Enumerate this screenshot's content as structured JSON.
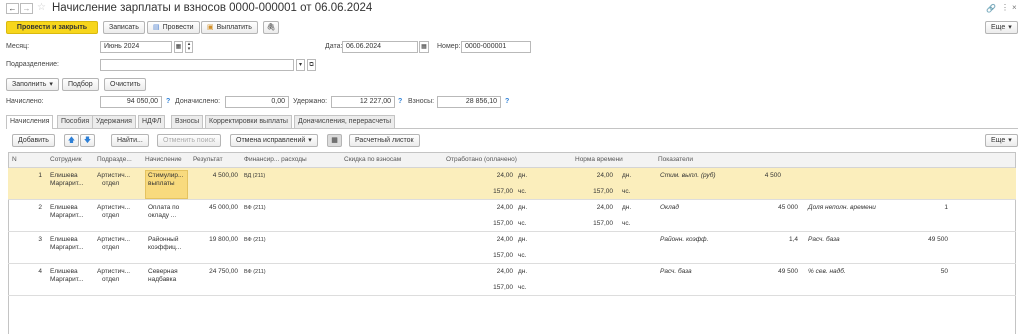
{
  "window": {
    "title": "Начисление зарплаты и взносов 0000-000001 от 06.06.2024",
    "more_label": "Еще"
  },
  "toolbar": {
    "post_close": "Провести и закрыть",
    "save": "Записать",
    "post": "Провести",
    "pay": "Выплатить"
  },
  "form": {
    "month_label": "Месяц:",
    "month_value": "Июнь 2024",
    "date_label": "Дата:",
    "date_value": "06.06.2024",
    "number_label": "Номер:",
    "number_value": "0000-000001",
    "division_label": "Подразделение:",
    "division_value": "",
    "fill_button": "Заполнить",
    "selection_button": "Подбор",
    "clear_button": "Очистить",
    "accrued_label": "Начислено:",
    "accrued_value": "94 050,00",
    "additional_label": "Доначислено:",
    "additional_value": "0,00",
    "withheld_label": "Удержано:",
    "withheld_value": "12 227,00",
    "contrib_label": "Взносы:",
    "contrib_value": "28 856,10",
    "help": "?"
  },
  "tabs": [
    "Начисления",
    "Пособия",
    "Удержания",
    "НДФЛ",
    "Взносы",
    "Корректировки выплаты",
    "Доначисления, перерасчеты"
  ],
  "table_toolbar": {
    "add": "Добавить",
    "find": "Найти...",
    "cancel_search": "Отменить поиск",
    "cancel_fix": "Отмена исправлений",
    "payslip": "Расчетный листок",
    "more": "Еще"
  },
  "columns": [
    "N",
    "Сотрудник",
    "Подразде...",
    "Начисление",
    "Результат",
    "Финансир... расходы",
    "Скидка по взносам",
    "Отработано (оплачено)",
    "Норма времени",
    "Показатели"
  ],
  "rows": [
    {
      "n": "1",
      "emp1": "Елишева",
      "emp2": "Маргарит...",
      "dep1": "Артистич...",
      "dep2": "отдел",
      "acc1": "Стимулир...",
      "acc2": "выплаты",
      "result": "4 500,00",
      "fin": "ВД (211)",
      "days": "24,00",
      "days_u": "дн.",
      "hours": "157,00",
      "hours_u": "чс.",
      "norm_d": "24,00",
      "norm_du": "дн.",
      "norm_h": "157,00",
      "norm_hu": "чс.",
      "ind1": "Стим. выпл. (руб)",
      "ind1v": "4 500",
      "ind2": "",
      "ind2v": ""
    },
    {
      "n": "2",
      "emp1": "Елишева",
      "emp2": "Маргарит...",
      "dep1": "Артистич...",
      "dep2": "отдел",
      "acc1": "Оплата по",
      "acc2": "окладу ...",
      "result": "45 000,00",
      "fin": "ВФ (211)",
      "days": "24,00",
      "days_u": "дн.",
      "hours": "157,00",
      "hours_u": "чс.",
      "norm_d": "24,00",
      "norm_du": "дн.",
      "norm_h": "157,00",
      "norm_hu": "чс.",
      "ind1": "Оклад",
      "ind1v": "45 000",
      "ind2": "Доля неполн. времени",
      "ind2v": "1"
    },
    {
      "n": "3",
      "emp1": "Елишева",
      "emp2": "Маргарит...",
      "dep1": "Артистич...",
      "dep2": "отдел",
      "acc1": "Районный",
      "acc2": "коэффиц...",
      "result": "19 800,00",
      "fin": "ВФ (211)",
      "days": "24,00",
      "days_u": "дн.",
      "hours": "157,00",
      "hours_u": "чс.",
      "norm_d": "",
      "norm_du": "",
      "norm_h": "",
      "norm_hu": "",
      "ind1": "Районн. коэфф.",
      "ind1v": "1,4",
      "ind2": "Расч. база",
      "ind2v": "49 500"
    },
    {
      "n": "4",
      "emp1": "Елишева",
      "emp2": "Маргарит...",
      "dep1": "Артистич...",
      "dep2": "отдел",
      "acc1": "Северная",
      "acc2": "надбавка",
      "result": "24 750,00",
      "fin": "ВФ (211)",
      "days": "24,00",
      "days_u": "дн.",
      "hours": "157,00",
      "hours_u": "чс.",
      "norm_d": "",
      "norm_du": "",
      "norm_h": "",
      "norm_hu": "",
      "ind1": "Расч. база",
      "ind1v": "49 500",
      "ind2": "% сев. надб.",
      "ind2v": "50"
    }
  ]
}
